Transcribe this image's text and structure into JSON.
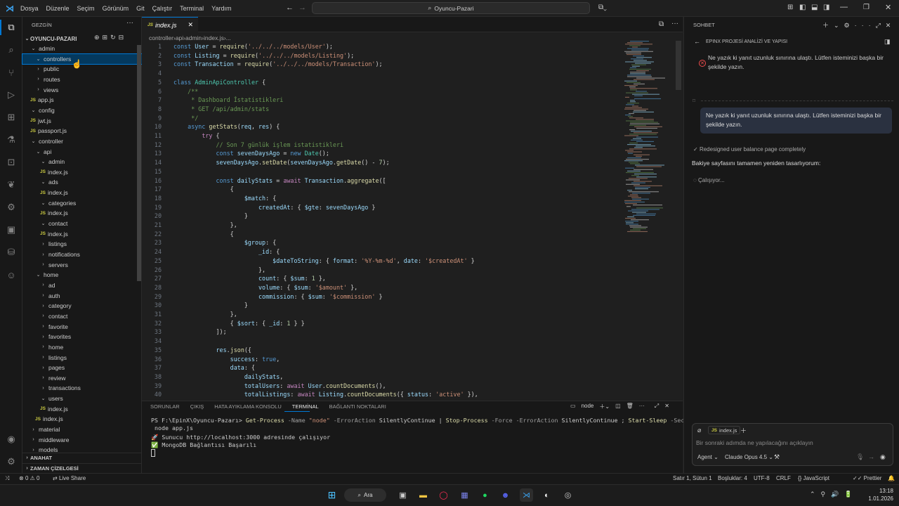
{
  "menu": [
    "Dosya",
    "Düzenle",
    "Seçim",
    "Görünüm",
    "Git",
    "Çalıştır",
    "Terminal",
    "Yardım"
  ],
  "search_label": "Oyuncu-Pazari",
  "sidebar": {
    "title": "GEZGİN",
    "root": "OYUNCU-PAZARI",
    "tree": [
      {
        "label": "admin",
        "kind": "folder-open",
        "depth": 1
      },
      {
        "label": "controllers",
        "kind": "folder-open",
        "depth": 2,
        "selected": true
      },
      {
        "label": "public",
        "kind": "folder",
        "depth": 2
      },
      {
        "label": "routes",
        "kind": "folder",
        "depth": 2
      },
      {
        "label": "views",
        "kind": "folder",
        "depth": 2
      },
      {
        "label": "app.js",
        "kind": "file",
        "depth": 1
      },
      {
        "label": "config",
        "kind": "folder-open",
        "depth": 1
      },
      {
        "label": "jwt.js",
        "kind": "file",
        "depth": 1
      },
      {
        "label": "passport.js",
        "kind": "file",
        "depth": 1
      },
      {
        "label": "controller",
        "kind": "folder-open",
        "depth": 1
      },
      {
        "label": "api",
        "kind": "folder-open",
        "depth": 2
      },
      {
        "label": "admin",
        "kind": "folder-open",
        "depth": 3
      },
      {
        "label": "index.js",
        "kind": "file",
        "depth": 3
      },
      {
        "label": "ads",
        "kind": "folder-open",
        "depth": 3
      },
      {
        "label": "index.js",
        "kind": "file",
        "depth": 3
      },
      {
        "label": "categories",
        "kind": "folder-open",
        "depth": 3
      },
      {
        "label": "index.js",
        "kind": "file",
        "depth": 3
      },
      {
        "label": "contact",
        "kind": "folder-open",
        "depth": 3
      },
      {
        "label": "index.js",
        "kind": "file",
        "depth": 3
      },
      {
        "label": "listings",
        "kind": "folder",
        "depth": 3
      },
      {
        "label": "notifications",
        "kind": "folder",
        "depth": 3
      },
      {
        "label": "servers",
        "kind": "folder",
        "depth": 3
      },
      {
        "label": "home",
        "kind": "folder-open",
        "depth": 2
      },
      {
        "label": "ad",
        "kind": "folder",
        "depth": 3
      },
      {
        "label": "auth",
        "kind": "folder",
        "depth": 3
      },
      {
        "label": "category",
        "kind": "folder",
        "depth": 3
      },
      {
        "label": "contact",
        "kind": "folder",
        "depth": 3
      },
      {
        "label": "favorite",
        "kind": "folder",
        "depth": 3
      },
      {
        "label": "favorites",
        "kind": "folder",
        "depth": 3
      },
      {
        "label": "home",
        "kind": "folder",
        "depth": 3
      },
      {
        "label": "listings",
        "kind": "folder",
        "depth": 3
      },
      {
        "label": "pages",
        "kind": "folder",
        "depth": 3
      },
      {
        "label": "review",
        "kind": "folder",
        "depth": 3
      },
      {
        "label": "transactions",
        "kind": "folder",
        "depth": 3
      },
      {
        "label": "users",
        "kind": "folder-open",
        "depth": 3
      },
      {
        "label": "index.js",
        "kind": "file",
        "depth": 3
      },
      {
        "label": "index.js",
        "kind": "file",
        "depth": 2
      },
      {
        "label": "material",
        "kind": "folder",
        "depth": 1
      },
      {
        "label": "middleware",
        "kind": "folder",
        "depth": 1
      },
      {
        "label": "models",
        "kind": "folder",
        "depth": 1
      }
    ],
    "outline_label": "ANAHAT",
    "timeline_label": "ZAMAN ÇİZELGESİ"
  },
  "editor": {
    "tab_label": "index.js",
    "breadcrumb": [
      "controller",
      "api",
      "admin",
      "index.js",
      "..."
    ]
  },
  "code_lines": [
    [
      [
        "k",
        "const "
      ],
      [
        "v",
        "User"
      ],
      [
        "t",
        " = "
      ],
      [
        "f",
        "require"
      ],
      [
        "t",
        "("
      ],
      [
        "s",
        "'../../../models/User'"
      ],
      [
        "t",
        ");"
      ]
    ],
    [
      [
        "k",
        "const "
      ],
      [
        "v",
        "Listing"
      ],
      [
        "t",
        " = "
      ],
      [
        "f",
        "require"
      ],
      [
        "t",
        "("
      ],
      [
        "s",
        "'../../../models/Listing'"
      ],
      [
        "t",
        ");"
      ]
    ],
    [
      [
        "k",
        "const "
      ],
      [
        "v",
        "Transaction"
      ],
      [
        "t",
        " = "
      ],
      [
        "f",
        "require"
      ],
      [
        "t",
        "("
      ],
      [
        "s",
        "'../../../models/Transaction'"
      ],
      [
        "t",
        ");"
      ]
    ],
    [],
    [
      [
        "k",
        "class "
      ],
      [
        "cl",
        "AdminApiController"
      ],
      [
        "t",
        " {"
      ]
    ],
    [
      [
        "c",
        "    /**"
      ]
    ],
    [
      [
        "c",
        "     * Dashboard İstatistikleri"
      ]
    ],
    [
      [
        "c",
        "     * GET /api/admin/stats"
      ]
    ],
    [
      [
        "c",
        "     */"
      ]
    ],
    [
      [
        "k",
        "    async "
      ],
      [
        "f",
        "getStats"
      ],
      [
        "t",
        "("
      ],
      [
        "v",
        "req"
      ],
      [
        "t",
        ", "
      ],
      [
        "v",
        "res"
      ],
      [
        "t",
        ") {"
      ]
    ],
    [
      [
        "kc",
        "        try"
      ],
      [
        "t",
        " {"
      ]
    ],
    [
      [
        "c",
        "            // Son 7 günlük işlem istatistikleri"
      ]
    ],
    [
      [
        "k",
        "            const "
      ],
      [
        "v",
        "sevenDaysAgo"
      ],
      [
        "t",
        " = "
      ],
      [
        "k",
        "new "
      ],
      [
        "cl",
        "Date"
      ],
      [
        "t",
        "();"
      ]
    ],
    [
      [
        "v",
        "            sevenDaysAgo"
      ],
      [
        "t",
        "."
      ],
      [
        "f",
        "setDate"
      ],
      [
        "t",
        "("
      ],
      [
        "v",
        "sevenDaysAgo"
      ],
      [
        "t",
        "."
      ],
      [
        "f",
        "getDate"
      ],
      [
        "t",
        "() - "
      ],
      [
        "n",
        "7"
      ],
      [
        "t",
        ");"
      ]
    ],
    [],
    [
      [
        "k",
        "            const "
      ],
      [
        "v",
        "dailyStats"
      ],
      [
        "t",
        " = "
      ],
      [
        "kc",
        "await "
      ],
      [
        "v",
        "Transaction"
      ],
      [
        "t",
        "."
      ],
      [
        "f",
        "aggregate"
      ],
      [
        "t",
        "(["
      ]
    ],
    [
      [
        "t",
        "                {"
      ]
    ],
    [
      [
        "v",
        "                    $match"
      ],
      [
        "t",
        ": {"
      ]
    ],
    [
      [
        "v",
        "                        createdAt"
      ],
      [
        "t",
        ": { "
      ],
      [
        "v",
        "$gte"
      ],
      [
        "t",
        ": "
      ],
      [
        "v",
        "sevenDaysAgo"
      ],
      [
        "t",
        " }"
      ]
    ],
    [
      [
        "t",
        "                    }"
      ]
    ],
    [
      [
        "t",
        "                },"
      ]
    ],
    [
      [
        "t",
        "                {"
      ]
    ],
    [
      [
        "v",
        "                    $group"
      ],
      [
        "t",
        ": {"
      ]
    ],
    [
      [
        "v",
        "                        _id"
      ],
      [
        "t",
        ": {"
      ]
    ],
    [
      [
        "v",
        "                            $dateToString"
      ],
      [
        "t",
        ": { "
      ],
      [
        "v",
        "format"
      ],
      [
        "t",
        ": "
      ],
      [
        "s",
        "'%Y-%m-%d'"
      ],
      [
        "t",
        ", "
      ],
      [
        "v",
        "date"
      ],
      [
        "t",
        ": "
      ],
      [
        "s",
        "'$createdAt'"
      ],
      [
        "t",
        " }"
      ]
    ],
    [
      [
        "t",
        "                        },"
      ]
    ],
    [
      [
        "v",
        "                        count"
      ],
      [
        "t",
        ": { "
      ],
      [
        "v",
        "$sum"
      ],
      [
        "t",
        ": "
      ],
      [
        "n",
        "1"
      ],
      [
        "t",
        " },"
      ]
    ],
    [
      [
        "v",
        "                        volume"
      ],
      [
        "t",
        ": { "
      ],
      [
        "v",
        "$sum"
      ],
      [
        "t",
        ": "
      ],
      [
        "s",
        "'$amount'"
      ],
      [
        "t",
        " },"
      ]
    ],
    [
      [
        "v",
        "                        commission"
      ],
      [
        "t",
        ": { "
      ],
      [
        "v",
        "$sum"
      ],
      [
        "t",
        ": "
      ],
      [
        "s",
        "'$commission'"
      ],
      [
        "t",
        " }"
      ]
    ],
    [
      [
        "t",
        "                    }"
      ]
    ],
    [
      [
        "t",
        "                },"
      ]
    ],
    [
      [
        "t",
        "                { "
      ],
      [
        "v",
        "$sort"
      ],
      [
        "t",
        ": { "
      ],
      [
        "v",
        "_id"
      ],
      [
        "t",
        ": "
      ],
      [
        "n",
        "1"
      ],
      [
        "t",
        " } }"
      ]
    ],
    [
      [
        "t",
        "            ]);"
      ]
    ],
    [],
    [
      [
        "v",
        "            res"
      ],
      [
        "t",
        "."
      ],
      [
        "f",
        "json"
      ],
      [
        "t",
        "({"
      ]
    ],
    [
      [
        "v",
        "                success"
      ],
      [
        "t",
        ": "
      ],
      [
        "k",
        "true"
      ],
      [
        "t",
        ","
      ]
    ],
    [
      [
        "v",
        "                data"
      ],
      [
        "t",
        ": {"
      ]
    ],
    [
      [
        "v",
        "                    dailyStats"
      ],
      [
        "t",
        ","
      ]
    ],
    [
      [
        "v",
        "                    totalUsers"
      ],
      [
        "t",
        ": "
      ],
      [
        "kc",
        "await "
      ],
      [
        "v",
        "User"
      ],
      [
        "t",
        "."
      ],
      [
        "f",
        "countDocuments"
      ],
      [
        "t",
        "(),"
      ]
    ],
    [
      [
        "v",
        "                    totalListings"
      ],
      [
        "t",
        ": "
      ],
      [
        "kc",
        "await "
      ],
      [
        "v",
        "Listing"
      ],
      [
        "t",
        "."
      ],
      [
        "f",
        "countDocuments"
      ],
      [
        "t",
        "({ "
      ],
      [
        "v",
        "status"
      ],
      [
        "t",
        ": "
      ],
      [
        "s",
        "'active'"
      ],
      [
        "t",
        " }),"
      ]
    ]
  ],
  "panel": {
    "tabs": [
      "SORUNLAR",
      "ÇIKIŞ",
      "HATA AYIKLAMA KONSOLU",
      "TERMİNAL",
      "BAĞLANTI NOKTALARI"
    ],
    "active_tab": "TERMİNAL",
    "terminal_name": "node",
    "prompt": "PS F:\\EpinX\\Oyuncu-Pazarı> ",
    "command_parts": [
      [
        "f",
        "Get-Process"
      ],
      [
        "g",
        " -Name "
      ],
      [
        "s",
        "\"node\""
      ],
      [
        "g",
        " -ErrorAction "
      ],
      [
        "t",
        "SilentlyContinue"
      ],
      [
        "t",
        " | "
      ],
      [
        "f",
        "Stop-Process"
      ],
      [
        "g",
        " -Force -ErrorAction "
      ],
      [
        "t",
        "SilentlyContinue"
      ],
      [
        "t",
        " ; "
      ],
      [
        "f",
        "Start-Sleep"
      ],
      [
        "g",
        " -Seconds "
      ],
      [
        "t",
        "2"
      ],
      [
        "t",
        " ;"
      ]
    ],
    "command_cont": " node app.js",
    "lines": [
      "🚀 Sunucu http://localhost:3000 adresinde çalışıyor",
      "✅ MongoDB Bağlantısı Başarılı"
    ]
  },
  "chat": {
    "title": "SOHBET",
    "session_title": "EPINX PROJESİ ANALİZİ VE YAPISI",
    "error_text": "Ne yazık ki yanıt uzunluk sınırına ulaştı. Lütfen isteminizi başka bir şekilde yazın.",
    "user_message": "Ne yazık ki yanıt uzunluk sınırına ulaştı. Lütfen isteminizi başka bir şekilde yazın.",
    "step_done": "Redesigned user balance page completely",
    "assistant_text": "Bakiye sayfasını tamamen yeniden tasarlıyorum:",
    "working": "Çalışıyor...",
    "context_file": "index.js",
    "input_placeholder": "Bir sonraki adımda ne yapılacağını açıklayın",
    "mode": "Agent",
    "model": "Claude Opus 4.5"
  },
  "status": {
    "errors": "0",
    "warnings": "0",
    "live_share": "Live Share",
    "position": "Satır 1, Sütun 1",
    "spaces": "Boşluklar: 4",
    "encoding": "UTF-8",
    "eol": "CRLF",
    "language": "JavaScript",
    "prettier": "Prettier"
  },
  "taskbar": {
    "search": "Ara",
    "time": "13:18",
    "date": "1.01.2026"
  }
}
